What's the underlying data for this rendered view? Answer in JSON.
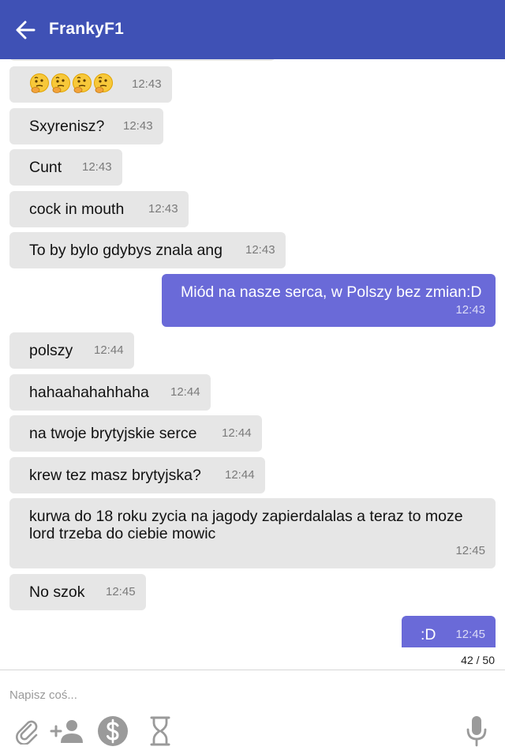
{
  "header": {
    "title": "FrankyF1"
  },
  "messages": [
    {
      "dir": "in",
      "text": "🤔🤔🤔🤔",
      "time": "12:43"
    },
    {
      "dir": "in",
      "text": "Sxyrenisz?",
      "time": "12:43"
    },
    {
      "dir": "in",
      "text": "Cunt",
      "time": "12:43"
    },
    {
      "dir": "in",
      "text": "cock in mouth",
      "time": "12:43"
    },
    {
      "dir": "in",
      "text": "To by bylo gdybys znala ang",
      "time": "12:43"
    },
    {
      "dir": "out",
      "text": "Miód na nasze serca, w Polszy bez zmian:D",
      "time": "12:43"
    },
    {
      "dir": "in",
      "text": "polszy",
      "time": "12:44"
    },
    {
      "dir": "in",
      "text": "hahaahahahhaha",
      "time": "12:44"
    },
    {
      "dir": "in",
      "text": "na twoje brytyjskie serce",
      "time": "12:44"
    },
    {
      "dir": "in",
      "text": "krew tez masz brytyjska?",
      "time": "12:44"
    },
    {
      "dir": "in",
      "line1": "kurwa do 18 roku zycia na jagody zapierdalalas a teraz to moze",
      "line2": "lord trzeba do ciebie mowic",
      "time": "12:45"
    },
    {
      "dir": "in",
      "text": "No szok",
      "time": "12:45"
    },
    {
      "dir": "out",
      "text": ":D",
      "time": "12:45"
    }
  ],
  "counter": "42 / 50",
  "composer": {
    "placeholder": "Napisz coś...",
    "tools": [
      "paperclip-icon",
      "add-person-icon",
      "dollar-coin-icon",
      "hourglass-icon",
      "microphone-icon"
    ]
  },
  "colors": {
    "header": "#3F51B5",
    "outgoing": "#6a6ad8",
    "incoming": "#e6e6e6"
  }
}
